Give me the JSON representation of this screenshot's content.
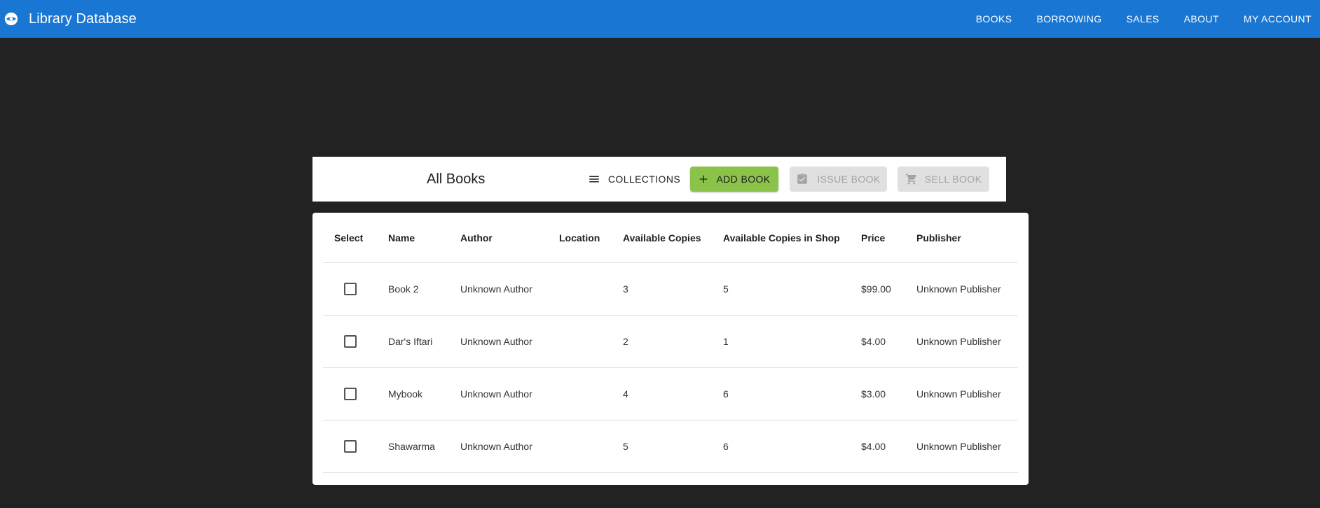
{
  "app": {
    "title": "Library Database",
    "logo_icon": "eye-logo-icon",
    "accent_color": "#1976d2"
  },
  "nav": {
    "items": [
      "BOOKS",
      "BORROWING",
      "SALES",
      "ABOUT",
      "MY ACCOUNT"
    ]
  },
  "toolbar": {
    "title": "All Books",
    "collections_label": "COLLECTIONS",
    "collections_icon": "menu-icon",
    "add_label": "ADD BOOK",
    "add_icon": "plus-icon",
    "add_color": "#8bc34a",
    "issue_label": "ISSUE BOOK",
    "issue_icon": "clipboard-check-icon",
    "issue_disabled": true,
    "sell_label": "SELL BOOK",
    "sell_icon": "cart-icon",
    "sell_disabled": true
  },
  "table": {
    "columns": [
      "Select",
      "Name",
      "Author",
      "Location",
      "Available Copies",
      "Available Copies in Shop",
      "Price",
      "Publisher"
    ],
    "rows": [
      {
        "selected": false,
        "name": "Book 2",
        "author": "Unknown Author",
        "location": "",
        "available": "3",
        "shop": "5",
        "price": "$99.00",
        "publisher": "Unknown Publisher"
      },
      {
        "selected": false,
        "name": "Dar's Iftari",
        "author": "Unknown Author",
        "location": "",
        "available": "2",
        "shop": "1",
        "price": "$4.00",
        "publisher": "Unknown Publisher"
      },
      {
        "selected": false,
        "name": "Mybook",
        "author": "Unknown Author",
        "location": "",
        "available": "4",
        "shop": "6",
        "price": "$3.00",
        "publisher": "Unknown Publisher"
      },
      {
        "selected": false,
        "name": "Shawarma",
        "author": "Unknown Author",
        "location": "",
        "available": "5",
        "shop": "6",
        "price": "$4.00",
        "publisher": "Unknown Publisher"
      }
    ]
  }
}
